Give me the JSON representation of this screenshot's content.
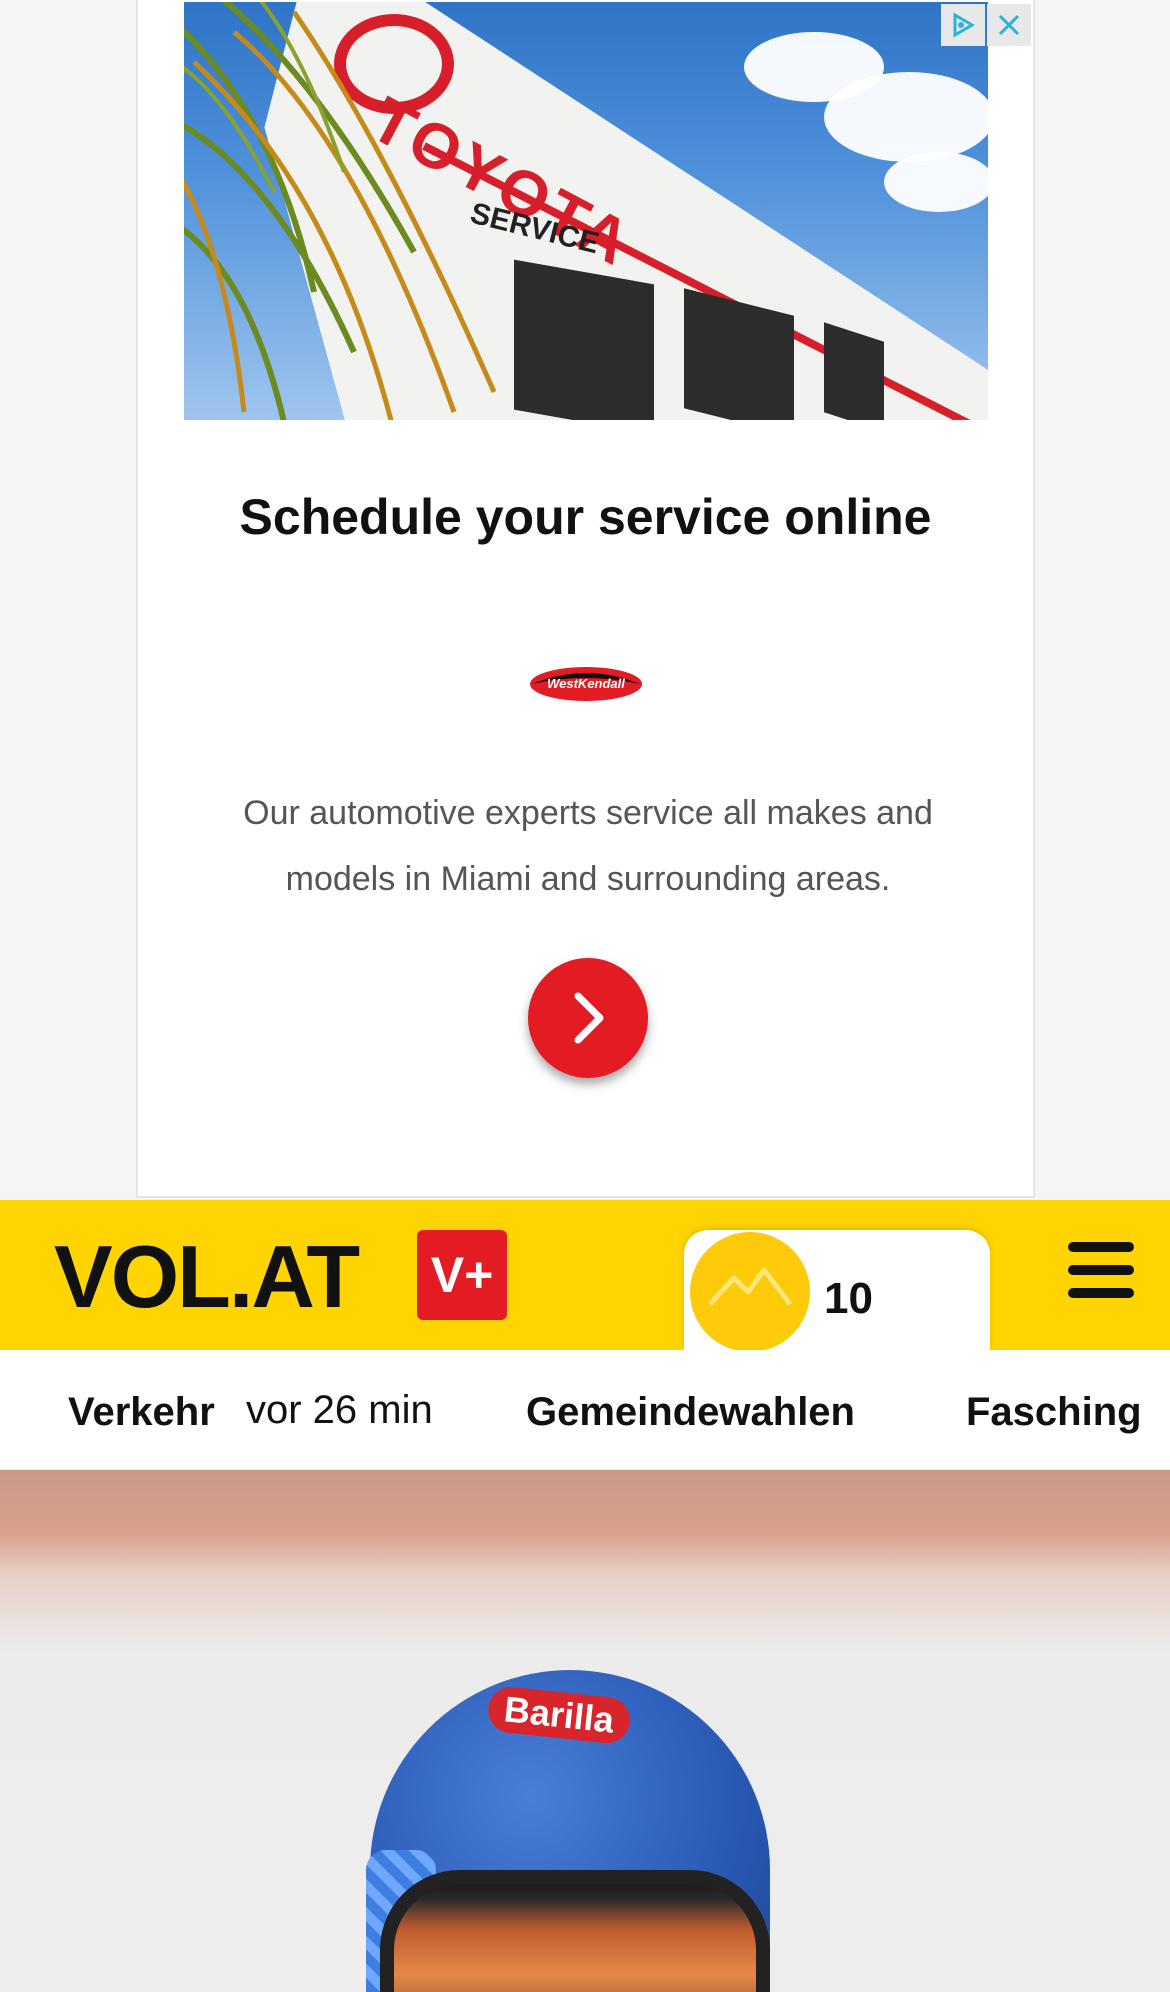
{
  "ad": {
    "headline": "Schedule your service online",
    "description": "Our automotive experts service all makes and models in Miami and surrounding areas.",
    "image_brand_text": "TOYOTA",
    "image_service_text": "SERVICE",
    "advertiser_logo_text": "West Kendall Toyota",
    "colors": {
      "cta": "#e31b23",
      "brand_red": "#d71f2b"
    },
    "icons": {
      "adchoices": "adchoices-icon",
      "close": "close-icon",
      "cta": "chevron-right-icon"
    }
  },
  "header": {
    "logo": "VOL.AT",
    "premium_badge": "V+",
    "weather": {
      "temperature": "10",
      "icon": "mountain-sun-icon"
    },
    "colors": {
      "background": "#ffd400",
      "badge": "#e31b23"
    }
  },
  "topics": [
    {
      "label": "Verkehr",
      "time": "vor 26 min"
    },
    {
      "label": "Gemeindewahlen"
    },
    {
      "label": "Fasching"
    }
  ],
  "hero": {
    "helmet_text": "Barilla"
  }
}
